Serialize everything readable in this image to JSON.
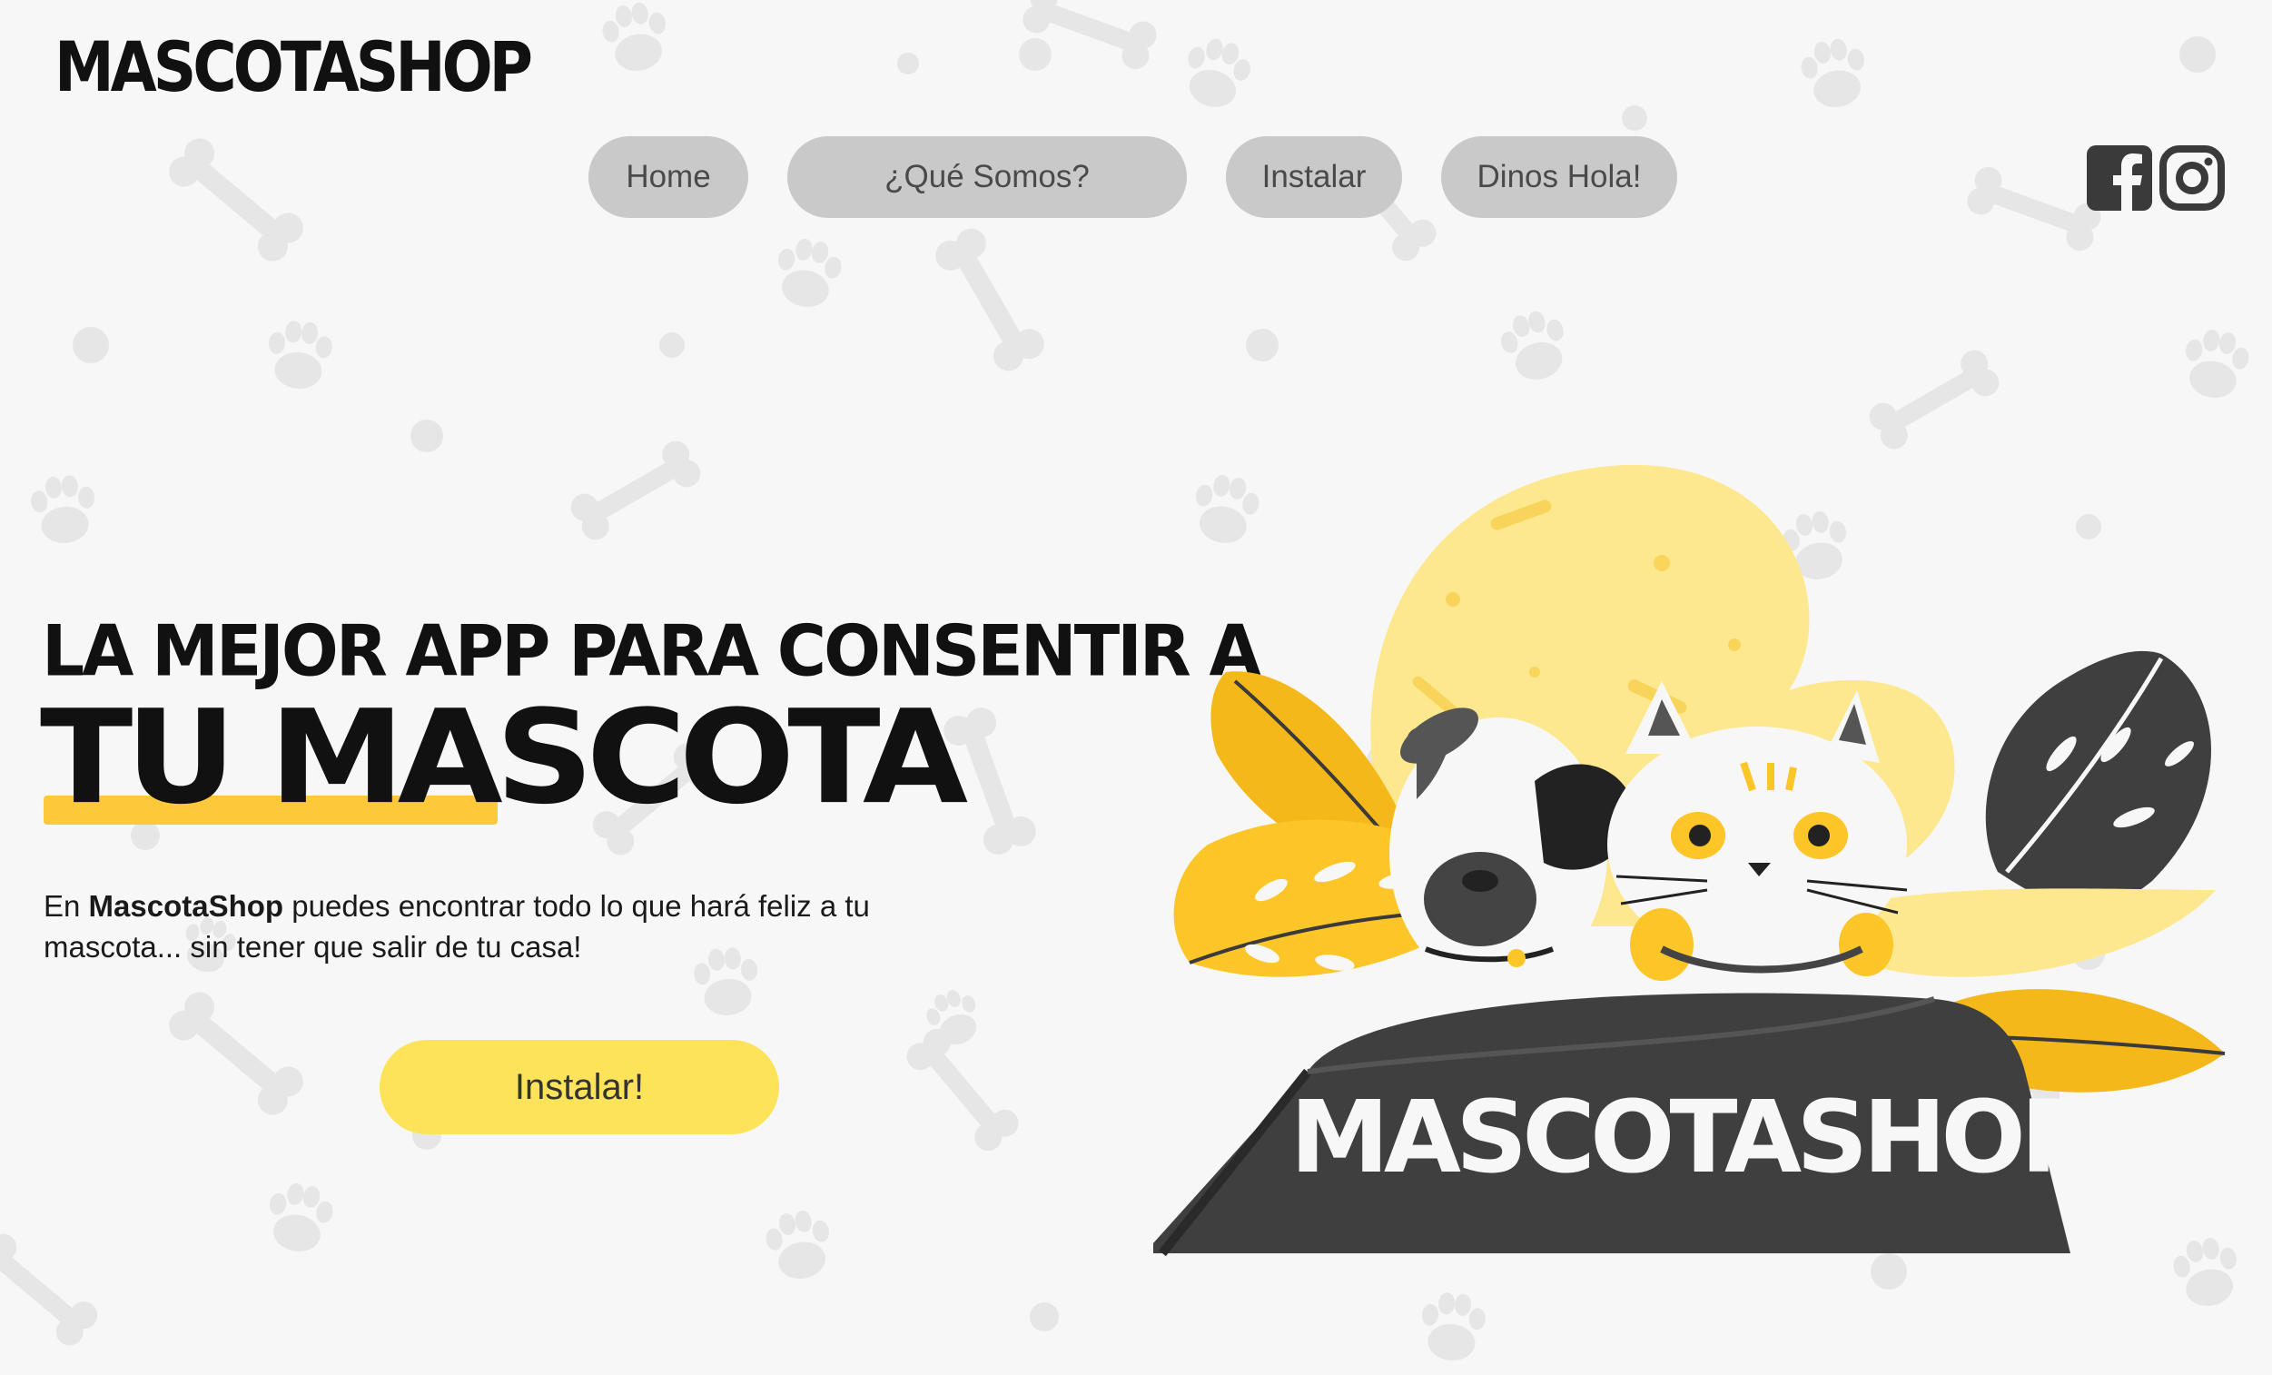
{
  "brand": {
    "logo_text": "MASCOTASHOP"
  },
  "nav": {
    "items": [
      {
        "label": "Home"
      },
      {
        "label": "¿Qué Somos?"
      },
      {
        "label": "Instalar"
      },
      {
        "label": "Dinos Hola!"
      }
    ]
  },
  "social": {
    "icons": [
      "facebook-icon",
      "instagram-icon"
    ]
  },
  "hero": {
    "headline_line1": "LA MEJOR APP PARA CONSENTIR A",
    "headline_line2": "TU MASCOTA",
    "description_prefix": "En ",
    "description_brand": "MascotaShop",
    "description_suffix": " puedes encontrar todo lo que hará feliz a tu mascota... sin tener que salir de tu casa!",
    "cta_label": "Instalar!",
    "illustration_sign": "MASCOTASHOP"
  },
  "colors": {
    "background": "#f7f7f7",
    "nav_button": "#c9c9c9",
    "accent_yellow": "#fdc83a",
    "cta_yellow": "#fde35a",
    "dark_gray": "#4a4a4a"
  }
}
